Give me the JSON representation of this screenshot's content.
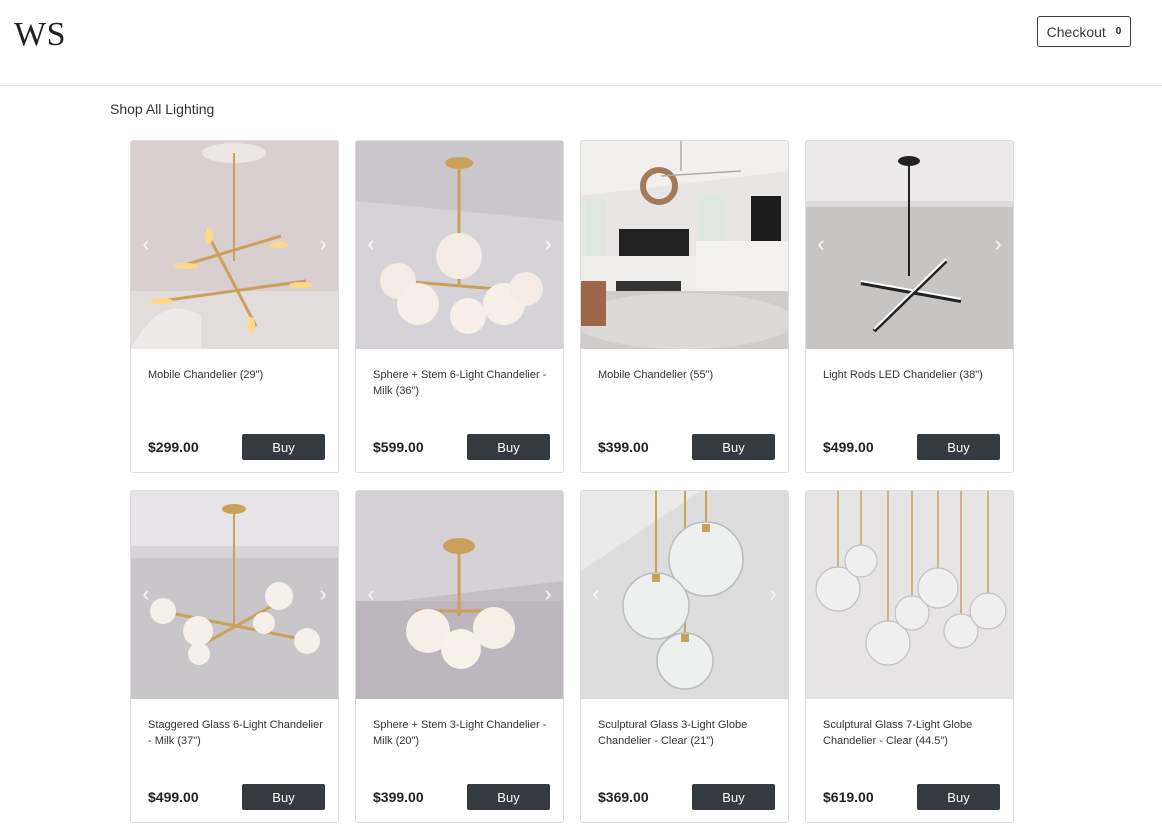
{
  "header": {
    "logo": "WS",
    "checkout_label": "Checkout",
    "checkout_count": "0"
  },
  "section": {
    "title": "Shop All Lighting"
  },
  "products": [
    {
      "name": "Mobile Chandelier (29\")",
      "price": "$299.00",
      "buy_label": "Buy"
    },
    {
      "name": "Sphere + Stem 6-Light Chandelier - Milk (36\")",
      "price": "$599.00",
      "buy_label": "Buy"
    },
    {
      "name": "Mobile Chandelier (55\")",
      "price": "$399.00",
      "buy_label": "Buy"
    },
    {
      "name": "Light Rods LED Chandelier (38\")",
      "price": "$499.00",
      "buy_label": "Buy"
    },
    {
      "name": "Staggered Glass 6-Light Chandelier - Milk (37\")",
      "price": "$499.00",
      "buy_label": "Buy"
    },
    {
      "name": "Sphere + Stem 3-Light Chandelier - Milk (20\")",
      "price": "$399.00",
      "buy_label": "Buy"
    },
    {
      "name": "Sculptural Glass 3-Light Globe Chandelier - Clear (21\")",
      "price": "$369.00",
      "buy_label": "Buy"
    },
    {
      "name": "Sculptural Glass 7-Light Globe Chandelier - Clear (44.5\")",
      "price": "$619.00",
      "buy_label": "Buy"
    }
  ],
  "icons": {
    "prev": "chevron-left-icon",
    "next": "chevron-right-icon"
  },
  "colors": {
    "button_dark": "#343a40",
    "brass": "#c9a15a"
  }
}
